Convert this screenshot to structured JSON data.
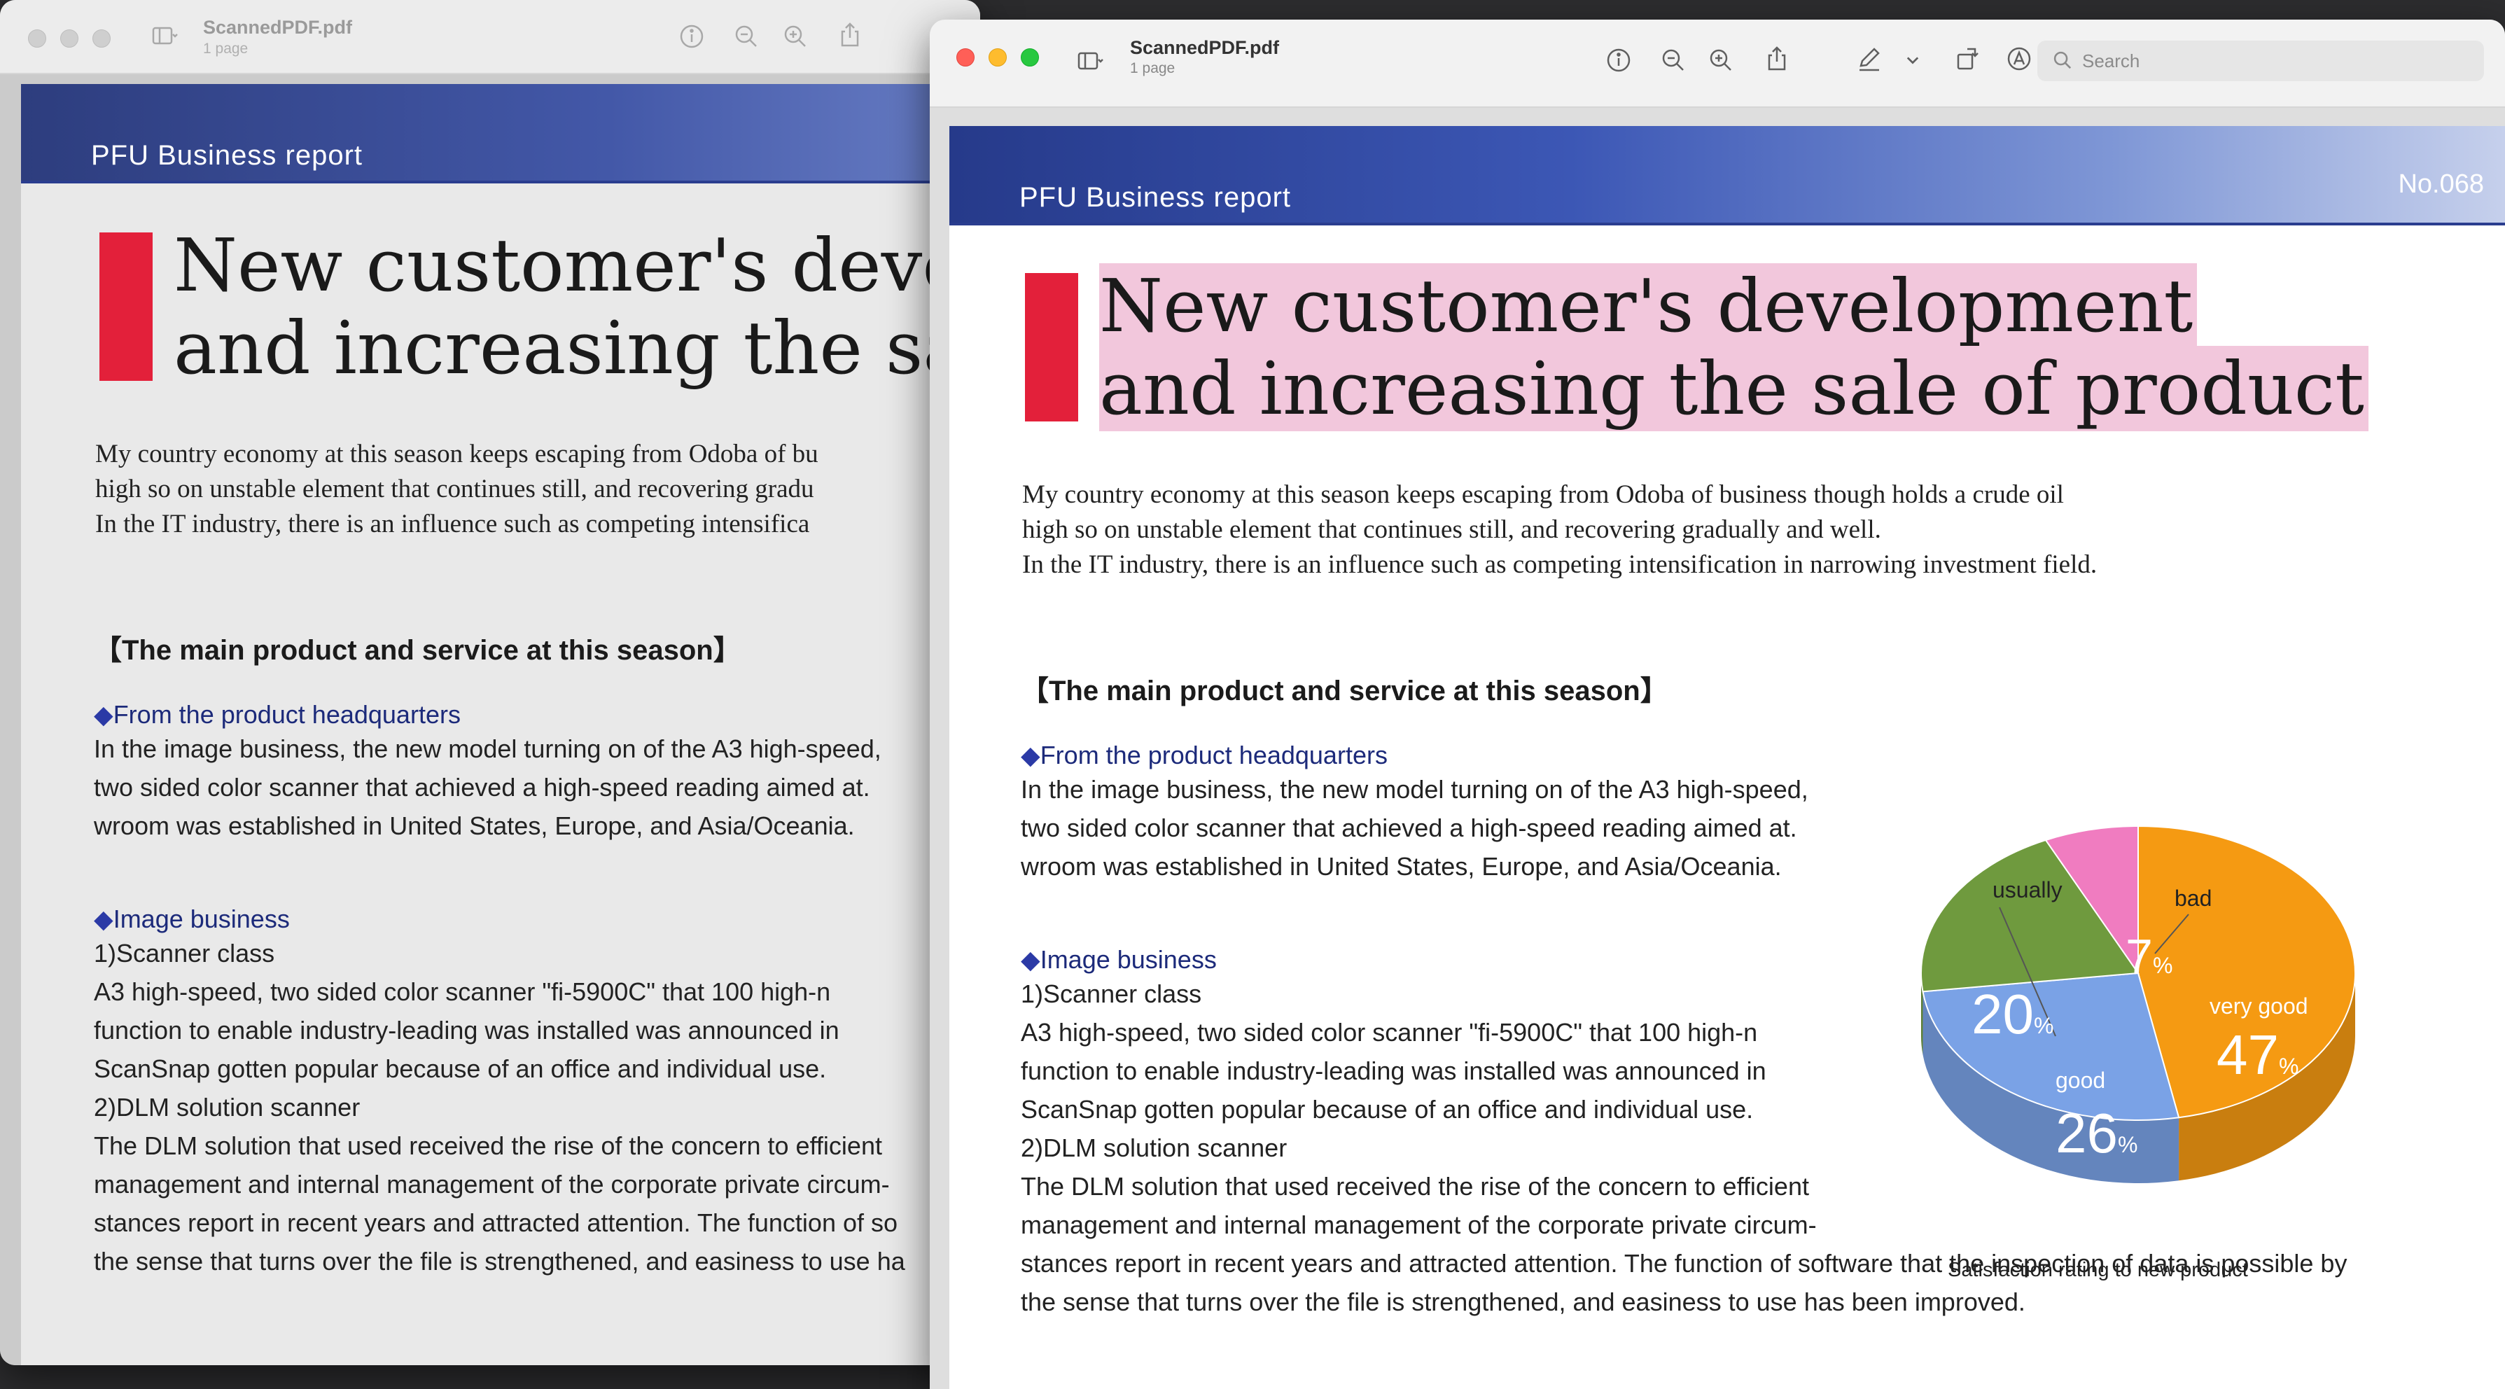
{
  "app": {
    "file_name": "ScannedPDF.pdf",
    "page_count": "1 page",
    "search_placeholder": "Search"
  },
  "document": {
    "banner_title": "PFU Business report",
    "issue_number": "No.068",
    "headline_line1": "New customer's development",
    "headline_line2": "and increasing the sale of product",
    "back_headline_line1": "New customer's develo",
    "back_headline_line2": "and increasing the sale",
    "intro_lines": [
      "My country economy at this season keeps escaping from Odoba of business though holds a crude oil",
      "high so on unstable element that continues still, and recovering gradually and well.",
      "In the IT industry, there is an influence such as competing intensification in narrowing investment field."
    ],
    "back_intro_lines": [
      "My country economy at this season keeps escaping from Odoba of bu",
      "high so on unstable element that continues still, and recovering gradu",
      "In the IT industry, there is an influence such as competing intensifica"
    ],
    "section_title": "【The main product and service at this season】",
    "sub1_title": "From the product headquarters",
    "sub1_lines": [
      "In the image business, the new model turning on of the A3 high-speed,",
      "two sided color scanner that achieved a high-speed reading aimed at.",
      "wroom was established in United States, Europe, and Asia/Oceania."
    ],
    "sub2_title": "Image business",
    "sub2_lines": [
      "1)Scanner class",
      "A3 high-speed, two sided color scanner \"fi-5900C\" that 100 high-n",
      "function to enable industry-leading was installed was announced in",
      "ScanSnap gotten popular because of an office and individual use.",
      "2)DLM solution scanner",
      "The DLM solution that used received the rise of the concern to efficient",
      "management and internal management of the corporate private circum-"
    ],
    "sub2_full_lines": [
      "stances report in recent years and attracted attention. The function of software that the inspection of data is possible by",
      "the sense that turns over the file is strengthened, and easiness to use has been improved."
    ],
    "back_sub2_tail": [
      "stances report in recent years and attracted attention. The function of so",
      "the sense that turns over the file is strengthened, and easiness to use ha"
    ],
    "chart_caption": "Satisfaction rating to new product"
  },
  "chart_data": {
    "type": "pie",
    "title": "Satisfaction rating to new product",
    "slices": [
      {
        "label": "very good",
        "value": 47,
        "display": "47",
        "color": "#f59a12"
      },
      {
        "label": "good",
        "value": 26,
        "display": "26",
        "color": "#7aa2e6"
      },
      {
        "label": "usually",
        "value": 20,
        "display": "20",
        "color": "#6f9a3e"
      },
      {
        "label": "bad",
        "value": 7,
        "display": "7",
        "color": "#f07cc0"
      }
    ],
    "unit": "%"
  },
  "colors": {
    "accent_red": "#e3203a",
    "banner_blue": "#2a3d8f",
    "highlight_pink": "#f2c7dc"
  }
}
